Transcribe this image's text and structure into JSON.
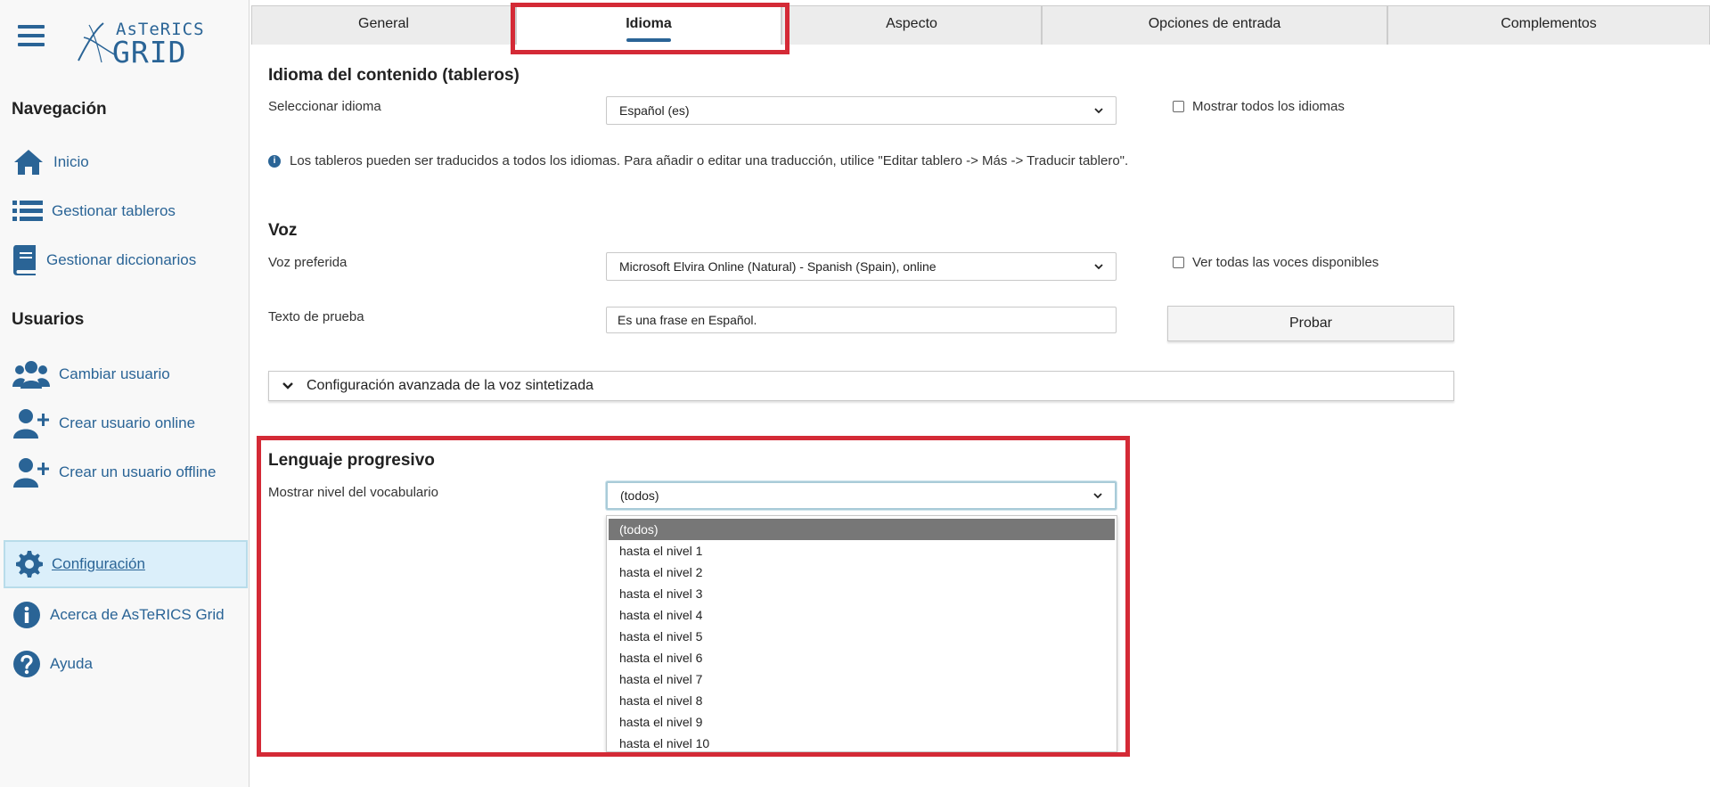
{
  "app": {
    "logo_top": "AsTeRICS",
    "logo_main": "GRID"
  },
  "sidebar": {
    "nav_heading": "Navegación",
    "nav_items": [
      {
        "label": "Inicio",
        "icon": "home-icon"
      },
      {
        "label": "Gestionar tableros",
        "icon": "list-icon"
      },
      {
        "label": "Gestionar diccionarios",
        "icon": "book-icon"
      }
    ],
    "users_heading": "Usuarios",
    "user_items": [
      {
        "label": "Cambiar usuario",
        "icon": "users-icon"
      },
      {
        "label": "Crear usuario online",
        "icon": "user-plus-icon"
      },
      {
        "label": "Crear un usuario offline",
        "icon": "user-plus-icon"
      }
    ],
    "bottom_items": [
      {
        "label": "Configuración",
        "icon": "gear-icon",
        "active": true
      },
      {
        "label": "Acerca de AsTeRICS Grid",
        "icon": "info-icon"
      },
      {
        "label": "Ayuda",
        "icon": "question-icon"
      }
    ]
  },
  "tabs": [
    {
      "label": "General"
    },
    {
      "label": "Idioma",
      "active": true
    },
    {
      "label": "Aspecto"
    },
    {
      "label": "Opciones de entrada"
    },
    {
      "label": "Complementos"
    }
  ],
  "content_language": {
    "title": "Idioma del contenido (tableros)",
    "select_label": "Seleccionar idioma",
    "selected": "Español (es)",
    "show_all_label": "Mostrar todos los idiomas",
    "info": "Los tableros pueden ser traducidos a todos los idiomas. Para añadir o editar una traducción, utilice \"Editar tablero -> Más -> Traducir tablero\"."
  },
  "voice": {
    "title": "Voz",
    "preferred_label": "Voz preferida",
    "preferred_value": "Microsoft Elvira Online (Natural) - Spanish (Spain), online",
    "show_all_label": "Ver todas las voces disponibles",
    "test_label": "Texto de prueba",
    "test_value": "Es una frase en Español.",
    "test_button": "Probar",
    "advanced_label": "Configuración avanzada de la voz sintetizada"
  },
  "progressive": {
    "title": "Lenguaje progresivo",
    "level_label": "Mostrar nivel del vocabulario",
    "level_value": "(todos)",
    "options": [
      "(todos)",
      "hasta el nivel 1",
      "hasta el nivel 2",
      "hasta el nivel 3",
      "hasta el nivel 4",
      "hasta el nivel 5",
      "hasta el nivel 6",
      "hasta el nivel 7",
      "hasta el nivel 8",
      "hasta el nivel 9",
      "hasta el nivel 10"
    ],
    "selected_index": 0
  },
  "colors": {
    "accent": "#2a6496",
    "highlight": "#d42a36",
    "active_nav_bg": "#dbeffa"
  }
}
